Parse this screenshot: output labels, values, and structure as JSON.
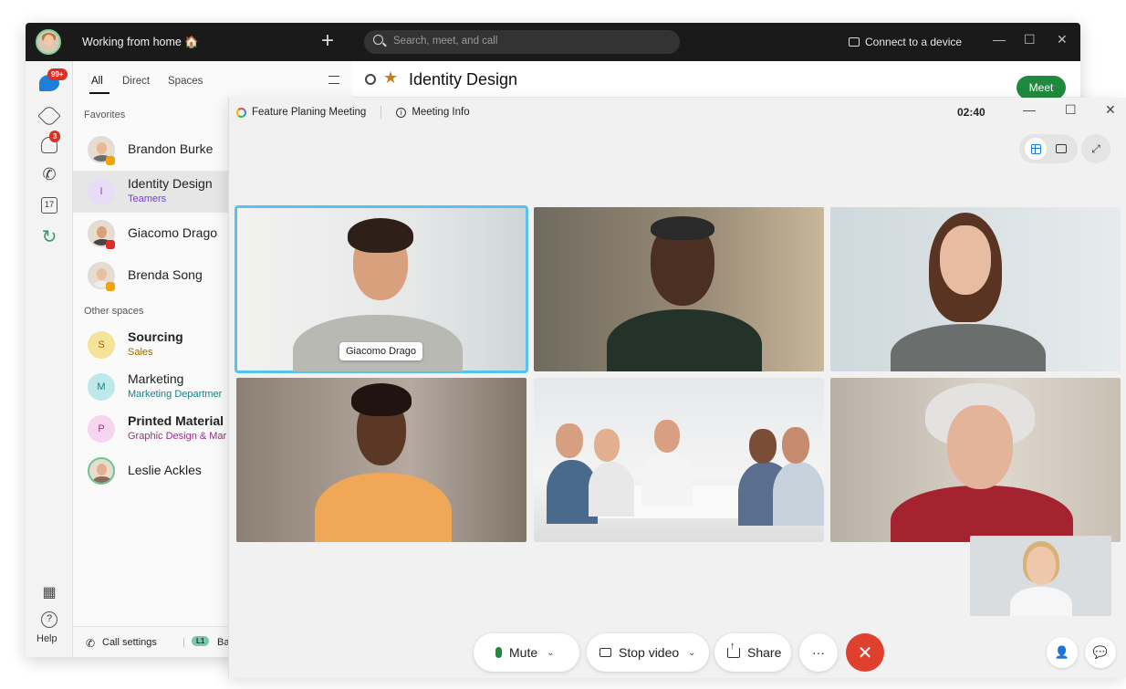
{
  "app": {
    "status_text": "Working from home",
    "status_emoji": "🏠",
    "new_label": "+",
    "search_placeholder": "Search, meet, and call",
    "connect_label": "Connect to a device",
    "window_controls": {
      "minimize": "—",
      "maximize": "☐",
      "close": "✕"
    }
  },
  "rail": {
    "messages_badge": "99+",
    "teams_icon": "teams-icon",
    "contacts_badge": "3",
    "calendar_day": "17",
    "help_label": "Help"
  },
  "list": {
    "tabs": [
      "All",
      "Direct",
      "Spaces"
    ],
    "favorites_label": "Favorites",
    "other_label": "Other spaces",
    "favorites": [
      {
        "name": "Brandon Burke",
        "presence": "#f0a30a"
      },
      {
        "name": "Identity Design",
        "sub": "Teamers",
        "initial": "I",
        "sub_color": "#7a3fd0",
        "avatar_bg": "#e9dcf7"
      },
      {
        "name": "Giacomo Drago",
        "presence": "#d93025"
      },
      {
        "name": "Brenda Song",
        "presence": "#f0a30a"
      }
    ],
    "others": [
      {
        "name": "Sourcing",
        "sub": "Sales",
        "initial": "S",
        "avatar_bg": "#f6e39a",
        "sub_color": "#9a6a00"
      },
      {
        "name": "Marketing",
        "sub": "Marketing Departmer",
        "initial": "M",
        "avatar_bg": "#bde9ea",
        "sub_color": "#1a7f86"
      },
      {
        "name": "Printed Material",
        "sub": "Graphic Design & Mar",
        "initial": "P",
        "avatar_bg": "#f6d6ee",
        "sub_color": "#9b2f84"
      },
      {
        "name": "Leslie Ackles"
      }
    ],
    "bottom": {
      "call_settings": "Call settings",
      "line_badge": "L1",
      "line_user": "Barbara Ger"
    }
  },
  "space": {
    "title": "Identity Design",
    "meet_label": "Meet"
  },
  "meeting": {
    "title": "Feature Planing Meeting",
    "info_label": "Meeting Info",
    "info_glyph": "i",
    "timer": "02:40",
    "active_speaker": "Giacomo Drago",
    "controls": {
      "mute": "Mute",
      "stop_video": "Stop video",
      "share": "Share",
      "more": "···",
      "end": "✕",
      "fullscreen": "⤢"
    }
  },
  "colors": {
    "accent_blue": "#1d7fd8",
    "meet_green": "#1f8a3d",
    "end_red": "#e0402e",
    "active_tile_border": "#55c3ee"
  }
}
